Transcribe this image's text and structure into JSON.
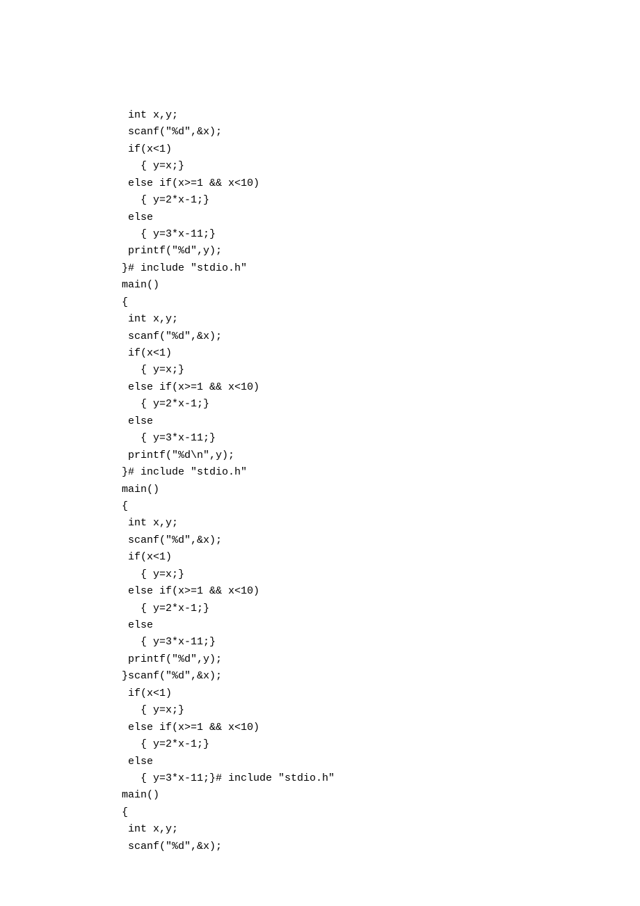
{
  "code": {
    "lines": [
      " int x,y;",
      " scanf(\"%d\",&x);",
      " if(x<1)",
      "   { y=x;}",
      " else if(x>=1 && x<10)",
      "   { y=2*x-1;}",
      " else",
      "   { y=3*x-11;}",
      " printf(\"%d\",y);",
      "}# include \"stdio.h\"",
      "main()",
      "{",
      " int x,y;",
      " scanf(\"%d\",&x);",
      " if(x<1)",
      "   { y=x;}",
      " else if(x>=1 && x<10)",
      "   { y=2*x-1;}",
      " else",
      "   { y=3*x-11;}",
      " printf(\"%d\\n\",y);",
      "}# include \"stdio.h\"",
      "main()",
      "{",
      " int x,y;",
      " scanf(\"%d\",&x);",
      " if(x<1)",
      "   { y=x;}",
      " else if(x>=1 && x<10)",
      "   { y=2*x-1;}",
      " else",
      "   { y=3*x-11;}",
      " printf(\"%d\",y);",
      "}scanf(\"%d\",&x);",
      " if(x<1)",
      "   { y=x;}",
      " else if(x>=1 && x<10)",
      "   { y=2*x-1;}",
      " else",
      "   { y=3*x-11;}# include \"stdio.h\"",
      "main()",
      "{",
      " int x,y;",
      " scanf(\"%d\",&x);"
    ]
  }
}
